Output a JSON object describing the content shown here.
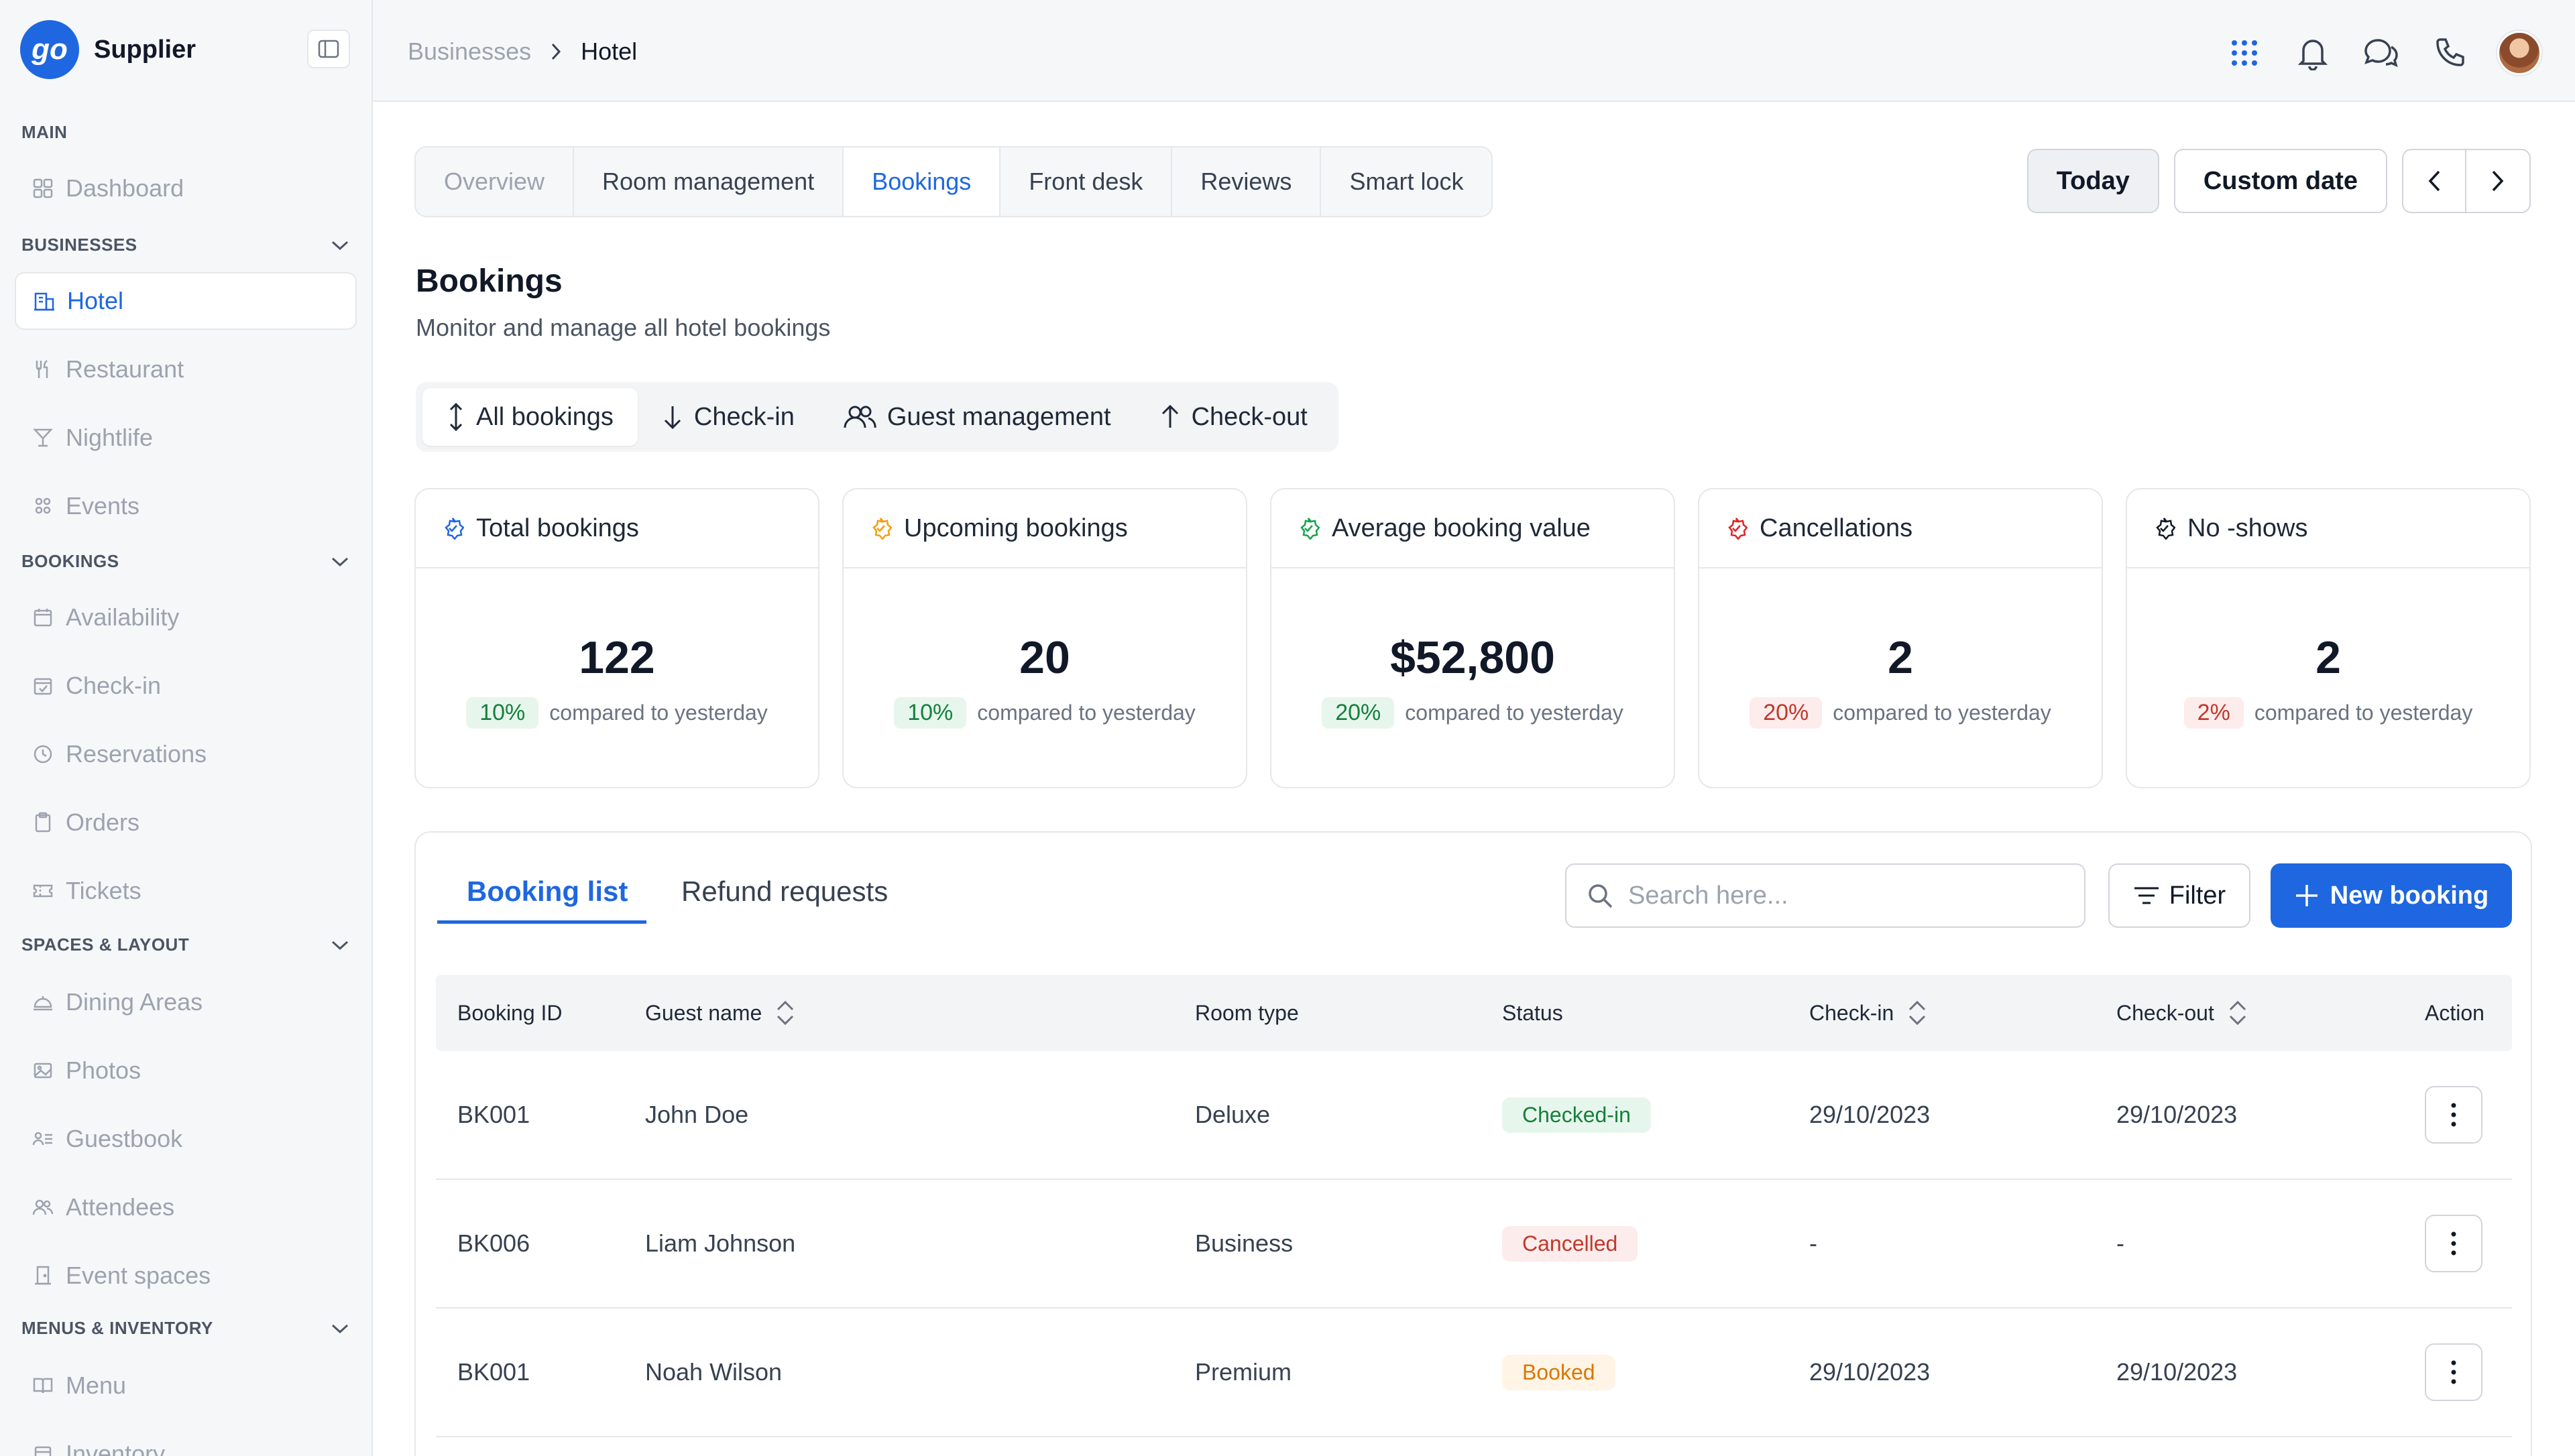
{
  "sidebar": {
    "logo_text": "go",
    "brand": "Supplier",
    "sections": {
      "main": "MAIN",
      "businesses": "BUSINESSES",
      "bookings": "BOOKINGS",
      "spaces": "SPACES & LAYOUT",
      "menus": "MENUS & INVENTORY"
    },
    "items": {
      "dashboard": "Dashboard",
      "hotel": "Hotel",
      "restaurant": "Restaurant",
      "nightlife": "Nightlife",
      "events": "Events",
      "availability": "Availability",
      "checkin": "Check-in",
      "reservations": "Reservations",
      "orders": "Orders",
      "tickets": "Tickets",
      "dining": "Dining Areas",
      "photos": "Photos",
      "guestbook": "Guestbook",
      "attendees": "Attendees",
      "event_spaces": "Event spaces",
      "menu": "Menu",
      "inventory": "Inventory"
    }
  },
  "header": {
    "breadcrumb_parent": "Businesses",
    "breadcrumb_current": "Hotel"
  },
  "tabs": [
    "Overview",
    "Room management",
    "Bookings",
    "Front desk",
    "Reviews",
    "Smart lock"
  ],
  "date_controls": {
    "today": "Today",
    "custom": "Custom date"
  },
  "page": {
    "title": "Bookings",
    "subtitle": "Monitor and manage all hotel bookings"
  },
  "subtabs": [
    "All bookings",
    "Check-in",
    "Guest management",
    "Check-out"
  ],
  "stats": [
    {
      "label": "Total bookings",
      "value": "122",
      "change": "10%",
      "compare": "compared to yesterday",
      "icon_color": "#1f67e0"
    },
    {
      "label": "Upcoming bookings",
      "value": "20",
      "change": "10%",
      "compare": "compared to yesterday",
      "icon_color": "#f59e0b"
    },
    {
      "label": "Average booking value",
      "value": "$52,800",
      "change": "20%",
      "compare": "compared to yesterday",
      "icon_color": "#16a34a"
    },
    {
      "label": "Cancellations",
      "value": "2",
      "change": "20%",
      "compare": "compared to yesterday",
      "icon_color": "#dc2626"
    },
    {
      "label": "No -shows",
      "value": "2",
      "change": "2%",
      "compare": "compared to yesterday",
      "icon_color": "#111827"
    }
  ],
  "panel": {
    "tab_active": "Booking list",
    "tab_inactive": "Refund requests",
    "search_placeholder": "Search here...",
    "filter": "Filter",
    "new_booking": "New booking"
  },
  "table": {
    "headers": {
      "id": "Booking ID",
      "guest": "Guest name",
      "room": "Room type",
      "status": "Status",
      "checkin": "Check-in",
      "checkout": "Check-out",
      "action": "Action"
    },
    "rows": [
      {
        "id": "BK001",
        "guest": "John Doe",
        "room": "Deluxe",
        "status": "Checked-in",
        "checkin": "29/10/2023",
        "checkout": "29/10/2023"
      },
      {
        "id": "BK006",
        "guest": "Liam Johnson",
        "room": "Business",
        "status": "Cancelled",
        "checkin": "-",
        "checkout": "-"
      },
      {
        "id": "BK001",
        "guest": "Noah Wilson",
        "room": "Premium",
        "status": "Booked",
        "checkin": "29/10/2023",
        "checkout": "29/10/2023"
      }
    ]
  }
}
